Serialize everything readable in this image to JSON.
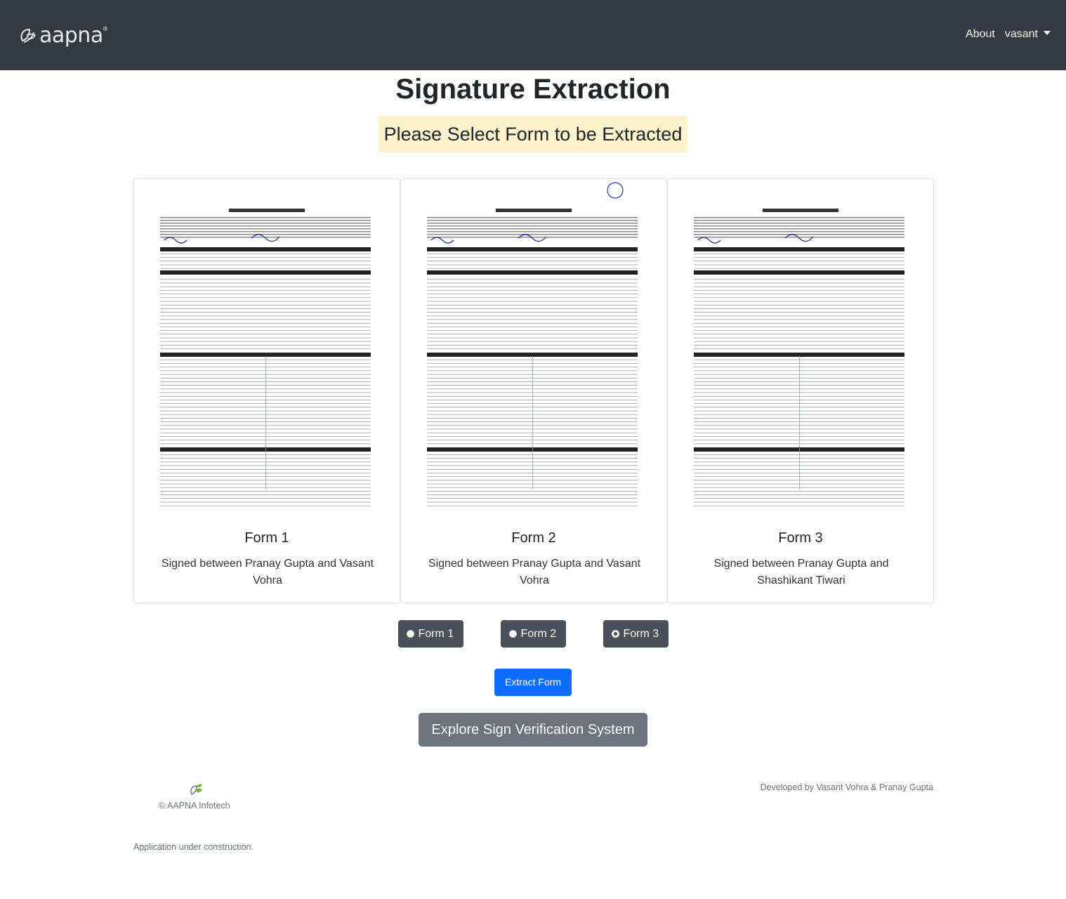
{
  "navbar": {
    "brand": "aapna",
    "brand_mark": "®",
    "about": "About",
    "user": "vasant",
    "colors": {
      "background": "#343a40",
      "text": "#ffffff"
    }
  },
  "page": {
    "title": "Signature Extraction",
    "subtitle": "Please Select Form to be Extracted"
  },
  "cards": [
    {
      "title": "Form 1",
      "description": "Signed between Pranay Gupta and Vasant Vohra",
      "image": "uniform-residential-loan-application-scan"
    },
    {
      "title": "Form 2",
      "description": "Signed between Pranay Gupta and Vasant Vohra",
      "image": "uniform-residential-loan-application-scan"
    },
    {
      "title": "Form 3",
      "description": "Signed between Pranay Gupta and Shashikant Tiwari",
      "image": "uniform-residential-loan-application-scan"
    }
  ],
  "form_options": [
    {
      "label": "Form 1",
      "checked": false
    },
    {
      "label": "Form 2",
      "checked": false
    },
    {
      "label": "Form 3",
      "checked": true
    }
  ],
  "actions": {
    "extract_label": "Extract Form",
    "explore_label": "Explore Sign Verification System",
    "colors": {
      "primary": "#0d6efd",
      "secondary": "#6c757d",
      "radio": "#495057"
    }
  },
  "footer": {
    "copyright": "© AAPNA Infotech",
    "developed_by": "Developed by Vasant Vohra & Pranay Gupta",
    "notice": "Application under construction."
  }
}
